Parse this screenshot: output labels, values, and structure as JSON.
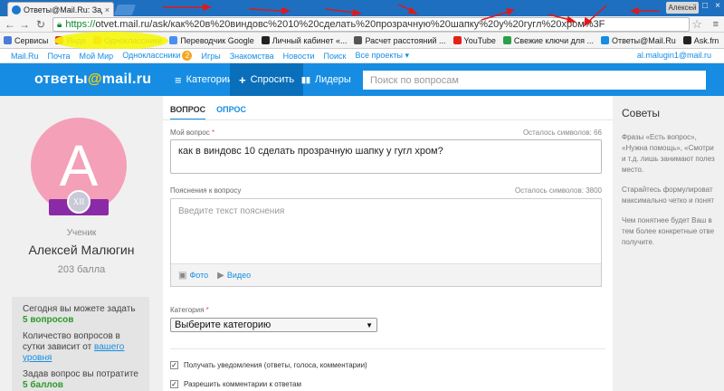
{
  "browser": {
    "tab_title": "Ответы@Mail.Ru: Задать",
    "tab_close": "×",
    "user_badge": "Алексей",
    "url_https": "https://",
    "url_rest": "otvet.mail.ru/ask/как%20в%20виндовс%2010%20сделать%20прозрачную%20шапку%20у%20гугл%20хром%3F",
    "bookmarks": [
      {
        "label": "Сервисы",
        "color": "#4a7bd6"
      },
      {
        "label": "Янде",
        "color": "#e02020"
      },
      {
        "label": "Одноклассники",
        "color": "#f58220"
      },
      {
        "label": "Переводчик Google",
        "color": "#4a8ef5"
      },
      {
        "label": "Личный кабинет «...",
        "color": "#222222"
      },
      {
        "label": "Расчет расстояний ...",
        "color": "#555555"
      },
      {
        "label": "YouTube",
        "color": "#e62117"
      },
      {
        "label": "Свежие ключи для ...",
        "color": "#2aa04a"
      },
      {
        "label": "Ответы@Mail.Ru",
        "color": "#168de2"
      },
      {
        "label": "Ask.fm",
        "color": "#222222"
      }
    ]
  },
  "portal": {
    "links": [
      "Mail.Ru",
      "Почта",
      "Мой Мир",
      "Одноклассники",
      "Игры",
      "Знакомства",
      "Новости",
      "Поиск",
      "Все проекты"
    ],
    "ok_badge": "2",
    "email": "al.malugin1@mail.ru"
  },
  "header": {
    "logo_main": "ответы",
    "logo_at": "@",
    "logo_tail": "mail.ru",
    "nav": [
      {
        "label": "Категории",
        "icon": "≡"
      },
      {
        "label": "Спросить",
        "icon": "+"
      },
      {
        "label": "Лидеры",
        "icon": "▮▮"
      }
    ],
    "search_placeholder": "Поиск по вопросам"
  },
  "profile": {
    "avatar_letter": "A",
    "medal": "XII",
    "rank": "Ученик",
    "name": "Алексей Малюгин",
    "points": "203 балла",
    "limits": {
      "today_label": "Сегодня вы можете задать",
      "today_value": "5 вопросов",
      "count_text": "Количество вопросов в сутки зависит от",
      "count_link": "вашего уровня",
      "cost_label": "Задав вопрос вы потратите",
      "cost_value": "5 баллов"
    }
  },
  "form": {
    "tab_question": "ВОПРОС",
    "tab_poll": "ОПРОС",
    "question_label": "Мой вопрос",
    "question_remaining": "Осталось символов: 66",
    "question_value": "как в виндовс 10 сделать прозрачную шапку у гугл хром?",
    "desc_label": "Пояснения к вопросу",
    "desc_remaining": "Осталось символов: 3800",
    "desc_placeholder": "Введите текст пояснения",
    "photo_label": "Фото",
    "video_label": "Видео",
    "category_label": "Категория",
    "category_value": "Выберите категорию",
    "notify_label": "Получать уведомления (ответы, голоса, комментарии)",
    "comments_label": "Разрешить комментарии к ответам",
    "required_mark": "*"
  },
  "tips": {
    "title": "Советы",
    "p1": "Фразы «Есть вопрос»,\n«Нужна помощь», «Смотри\nи т.д. лишь занимают полез\nместо.",
    "p2": "Старайтесь формулироват\nмаксимально четко и понят",
    "p3": "Чем понятнее будет Ваш в\nтем более конкретные отве\nполучите."
  }
}
